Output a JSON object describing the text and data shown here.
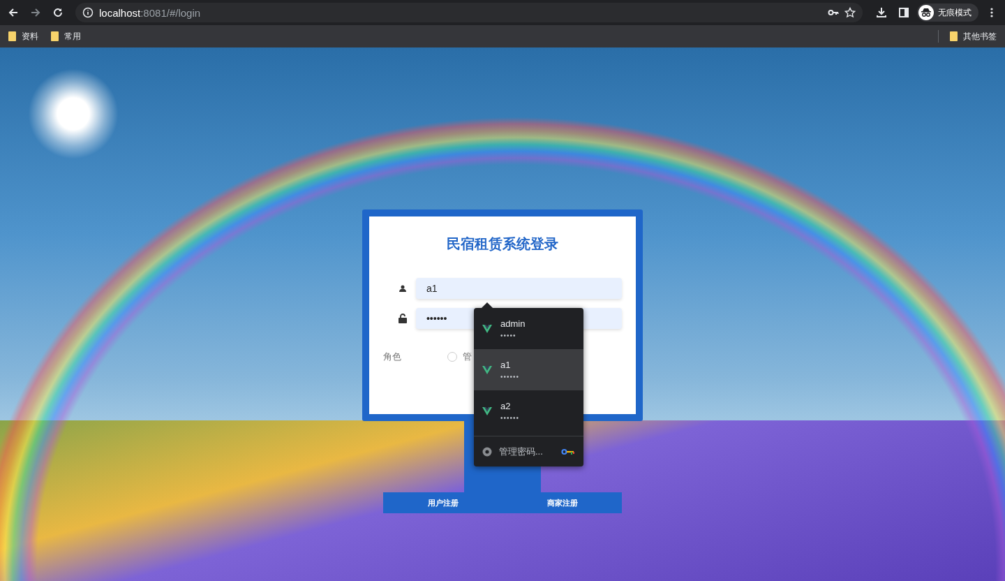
{
  "browser": {
    "url_host": "localhost",
    "url_rest": ":8081/#/login",
    "profile_label": "无痕模式",
    "bookmarks": [
      {
        "label": "资料"
      },
      {
        "label": "常用"
      }
    ],
    "other_bookmarks": "其他书签"
  },
  "login": {
    "title": "民宿租赁系统登录",
    "username": {
      "value": "a1"
    },
    "password": {
      "value": "••••••"
    },
    "role_label": "角色",
    "role_options": [
      {
        "label": "管",
        "selected": false
      }
    ]
  },
  "register_buttons": [
    {
      "label": "用户注册"
    },
    {
      "label": "商家注册"
    }
  ],
  "autofill": {
    "items": [
      {
        "username": "admin",
        "password": "•••••",
        "selected": false
      },
      {
        "username": "a1",
        "password": "••••••",
        "selected": true
      },
      {
        "username": "a2",
        "password": "••••••",
        "selected": false
      }
    ],
    "manage_label": "管理密码..."
  }
}
